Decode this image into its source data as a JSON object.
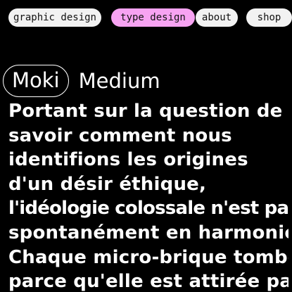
{
  "nav": {
    "items": [
      {
        "label": "graphic design",
        "active": false
      },
      {
        "label": "type design",
        "active": true
      },
      {
        "label": "about",
        "active": false
      },
      {
        "label": "shop",
        "active": false
      }
    ]
  },
  "font": {
    "name": "Moki",
    "weight": "Medium"
  },
  "specimen": {
    "lines": [
      "Portant sur la question de",
      "savoir comment nous",
      "identifions les origines",
      "d'un désir éthique,",
      "l'idéologie colossale n'est pas",
      "spontanément en harmonie.",
      "Chaque micro-brique tombe",
      "parce qu'elle est attirée par"
    ]
  },
  "colors": {
    "background": "#000000",
    "pill": "#f2f2f2",
    "active_pill": "#f7a3f2",
    "text": "#ffffff"
  }
}
